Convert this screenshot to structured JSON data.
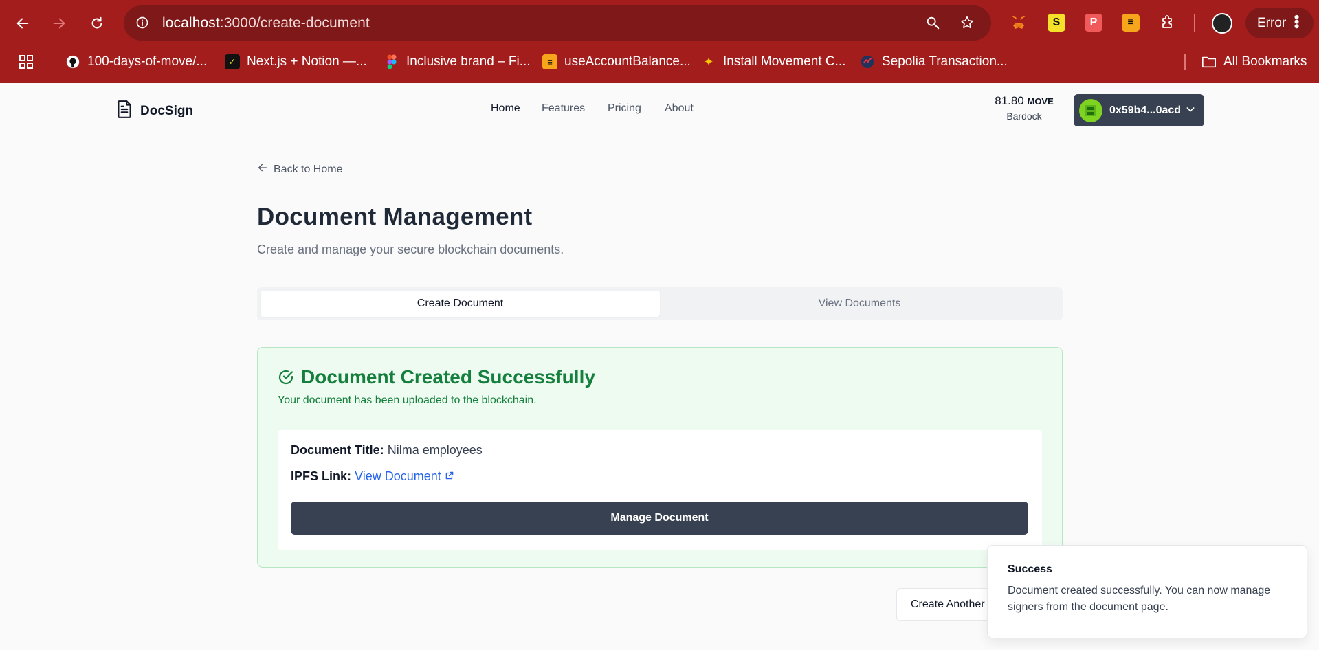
{
  "browser": {
    "url_host": "localhost",
    "url_path": ":3000/create-document",
    "error_label": "Error",
    "bookmarks": [
      {
        "label": "100-days-of-move/..."
      },
      {
        "label": "Next.js + Notion —..."
      },
      {
        "label": "Inclusive brand – Fi..."
      },
      {
        "label": "useAccountBalance..."
      },
      {
        "label": "Install Movement C..."
      },
      {
        "label": "Sepolia Transaction..."
      }
    ],
    "all_bookmarks": "All Bookmarks"
  },
  "header": {
    "logo_text": "DocSign",
    "nav": [
      {
        "label": "Home"
      },
      {
        "label": "Features"
      },
      {
        "label": "Pricing"
      },
      {
        "label": "About"
      }
    ],
    "balance_amount": "81.80",
    "balance_unit": "MOVE",
    "network": "Bardock",
    "wallet_address": "0x59b4...0acd"
  },
  "main": {
    "back_label": "Back to Home",
    "title": "Document Management",
    "subtitle": "Create and manage your secure blockchain documents.",
    "tabs": [
      {
        "label": "Create Document"
      },
      {
        "label": "View Documents"
      }
    ],
    "success": {
      "title": "Document Created Successfully",
      "subtitle": "Your document has been uploaded to the blockchain.",
      "doc_title_label": "Document Title:",
      "doc_title_value": "Nilma employees",
      "ipfs_label": "IPFS Link:",
      "ipfs_link_text": "View Document",
      "manage_button": "Manage Document"
    },
    "create_another_button": "Create Another"
  },
  "toast": {
    "title": "Success",
    "message": "Document created successfully. You can now manage signers from the document page."
  },
  "colors": {
    "chrome": "#a31d1d",
    "success_green": "#15803d",
    "primary_dark": "#374151",
    "link_blue": "#2563eb"
  }
}
